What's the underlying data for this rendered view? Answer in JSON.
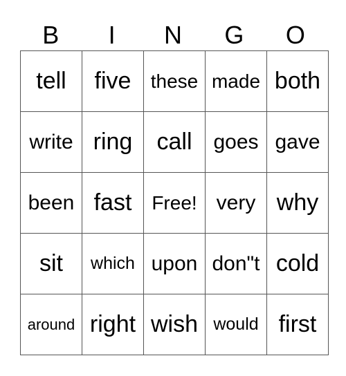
{
  "header": [
    "B",
    "I",
    "N",
    "G",
    "O"
  ],
  "rows": [
    [
      "tell",
      "five",
      "these",
      "made",
      "both"
    ],
    [
      "write",
      "ring",
      "call",
      "goes",
      "gave"
    ],
    [
      "been",
      "fast",
      "Free!",
      "very",
      "why"
    ],
    [
      "sit",
      "which",
      "upon",
      "don\"t",
      "cold"
    ],
    [
      "around",
      "right",
      "wish",
      "would",
      "first"
    ]
  ]
}
